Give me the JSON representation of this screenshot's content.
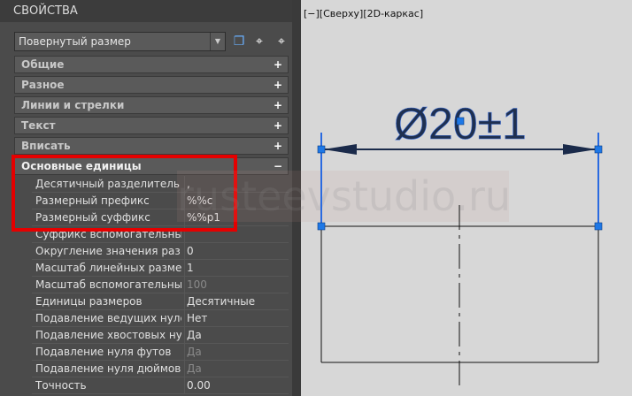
{
  "panel": {
    "title": "СВОЙСТВА",
    "object_type": "Повернутый размер",
    "toolbar_icons": [
      "select-objects-icon",
      "pick-add-icon",
      "quick-select-icon"
    ],
    "sections": [
      {
        "label": "Общие",
        "state": "+"
      },
      {
        "label": "Разное",
        "state": "+"
      },
      {
        "label": "Линии и стрелки",
        "state": "+"
      },
      {
        "label": "Текст",
        "state": "+"
      },
      {
        "label": "Вписать",
        "state": "+"
      },
      {
        "label": "Основные единицы",
        "state": "−"
      }
    ],
    "rows": [
      {
        "label": "Десятичный разделитель",
        "value": ","
      },
      {
        "label": "Размерный префикс",
        "value": "%%c"
      },
      {
        "label": "Размерный суффикс",
        "value": "%%p1"
      },
      {
        "label": "Суффикс  вспомогательных...",
        "value": ""
      },
      {
        "label": "Округление  значения  раз...",
        "value": "0"
      },
      {
        "label": "Масштаб  линейных  разме...",
        "value": "1"
      },
      {
        "label": "Масштаб  вспомогательны...",
        "value": "100"
      },
      {
        "label": "Единицы размеров",
        "value": "Десятичные"
      },
      {
        "label": "Подавление ведущих нулей",
        "value": "Нет"
      },
      {
        "label": "Подавление  хвостовых  ну...",
        "value": "Да"
      },
      {
        "label": "Подавление нуля футов",
        "value": "Да"
      },
      {
        "label": "Подавление нуля дюймов",
        "value": "Да"
      },
      {
        "label": "Точность",
        "value": "0.00"
      }
    ]
  },
  "viewport": {
    "label": "[−][Сверху][2D-каркас]",
    "dimension_text": "Ø20±1"
  },
  "watermark": "rusteevstudio.ru",
  "colors": {
    "highlight": "#e50000",
    "grip": "#1e78e6",
    "dim": "#1a2a4a"
  }
}
